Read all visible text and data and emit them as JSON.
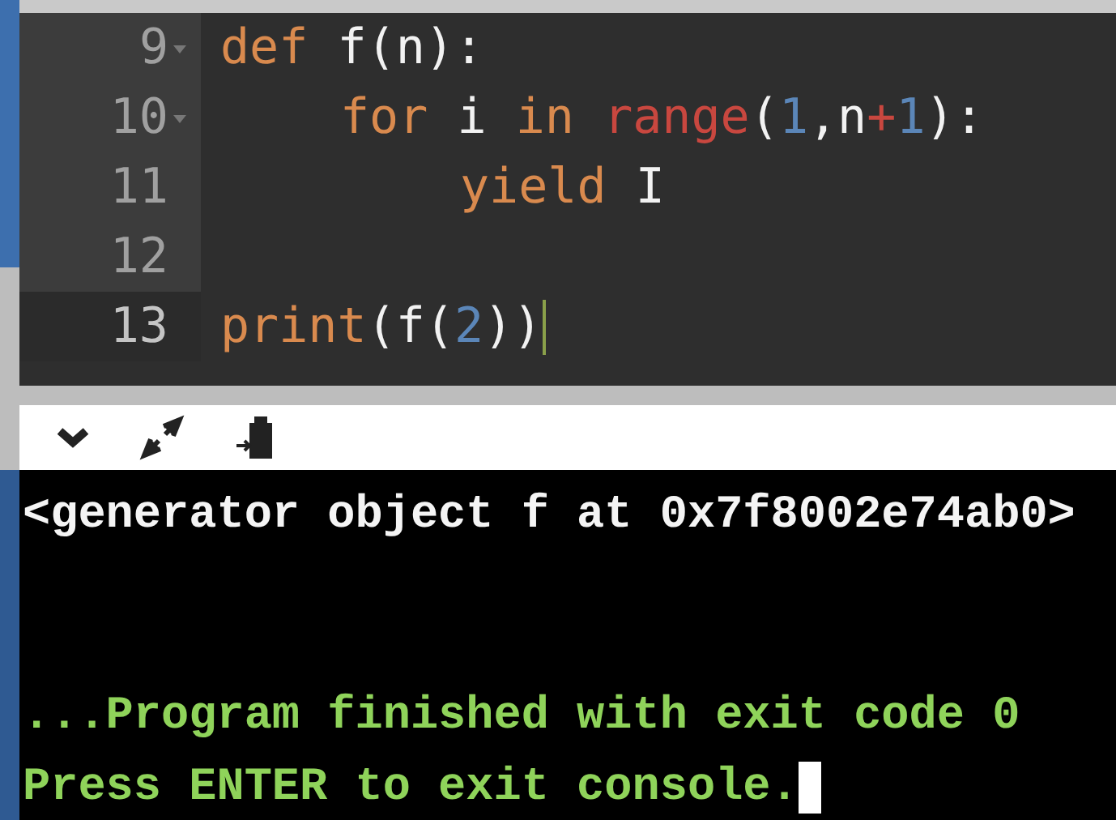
{
  "editor": {
    "lines": [
      {
        "number": "9",
        "foldable": true,
        "active": false,
        "tokens": [
          {
            "kind": "keyword",
            "text": "def"
          },
          {
            "kind": "plain",
            "text": " f(n):"
          }
        ],
        "children": [
          {
            "number": "10",
            "foldable": true,
            "active": false,
            "tokens": [
              {
                "kind": "keyword",
                "text": "for"
              },
              {
                "kind": "plain",
                "text": " i "
              },
              {
                "kind": "keyword",
                "text": "in "
              },
              {
                "kind": "builtin",
                "text": "range"
              },
              {
                "kind": "plain",
                "text": "("
              },
              {
                "kind": "number",
                "text": "1"
              },
              {
                "kind": "plain",
                "text": ",n"
              },
              {
                "kind": "builtin",
                "text": "+"
              },
              {
                "kind": "number",
                "text": "1"
              },
              {
                "kind": "plain",
                "text": "):"
              }
            ],
            "children": [
              {
                "number": "11",
                "foldable": false,
                "active": false,
                "tokens": [
                  {
                    "kind": "keyword",
                    "text": "yield"
                  },
                  {
                    "kind": "plain",
                    "text": " I"
                  }
                ]
              },
              {
                "number": "12",
                "foldable": false,
                "active": false
              }
            ]
          }
        ]
      },
      {
        "number": "13",
        "foldable": false,
        "active": true,
        "tokens": [
          {
            "kind": "keyword",
            "text": "print"
          },
          {
            "kind": "plain",
            "text": "(f("
          },
          {
            "kind": "number",
            "text": "2"
          },
          {
            "kind": "plain",
            "text": "))"
          }
        ]
      }
    ]
  },
  "console": {
    "output": "<generator object f at 0x7f8002e74ab0>",
    "status_lines": [
      "...Program finished with exit code 0",
      "Press ENTER to exit console."
    ]
  }
}
